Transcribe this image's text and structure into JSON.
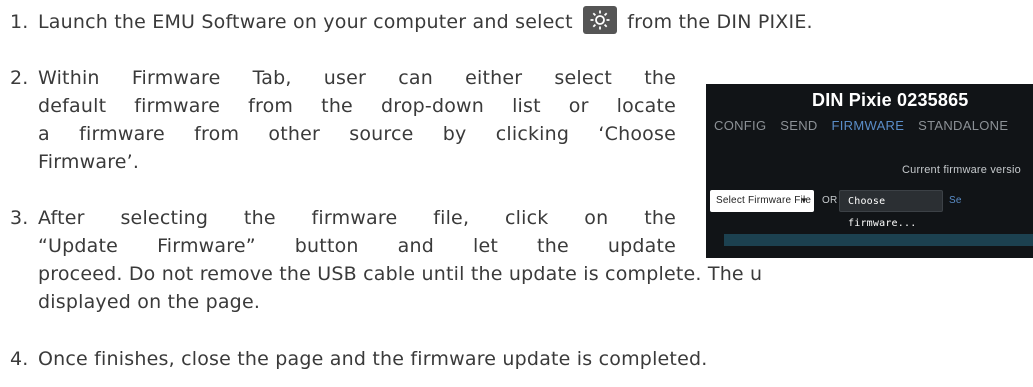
{
  "steps": [
    {
      "number": "1.",
      "lines": [
        "Launch the EMU Software on your computer and select",
        "from the DIN PIXIE."
      ]
    },
    {
      "number": "2.",
      "lines": [
        "Within Firmware Tab, user can either select the",
        "default firmware from the drop-down list or locate",
        "a firmware from other source by clicking ‘Choose",
        "Firmware’."
      ]
    },
    {
      "number": "3.",
      "lines": [
        "After selecting the firmware file, click on the",
        "“Update Firmware” button and let the update",
        "proceed. Do not remove the USB cable until the update is complete. The u",
        "displayed on the page."
      ]
    },
    {
      "number": "4.",
      "lines": [
        "Once finishes, close the page and the firmware update is completed."
      ]
    }
  ],
  "icon": "settings-gear-icon",
  "screenshot": {
    "title": "DIN Pixie 0235865",
    "tabs": [
      "CONFIG",
      "SEND",
      "FIRMWARE",
      "STANDALONE"
    ],
    "active_tab": "FIRMWARE",
    "firmware_version_label": "Current firmware versio",
    "select_placeholder": "Select Firmware File",
    "or_label": "OR",
    "choose_button": "Choose firmware...",
    "select_link": "Se",
    "colors": {
      "background": "#111417",
      "accent": "#5a8dc8",
      "progress": "#1c4150"
    }
  }
}
